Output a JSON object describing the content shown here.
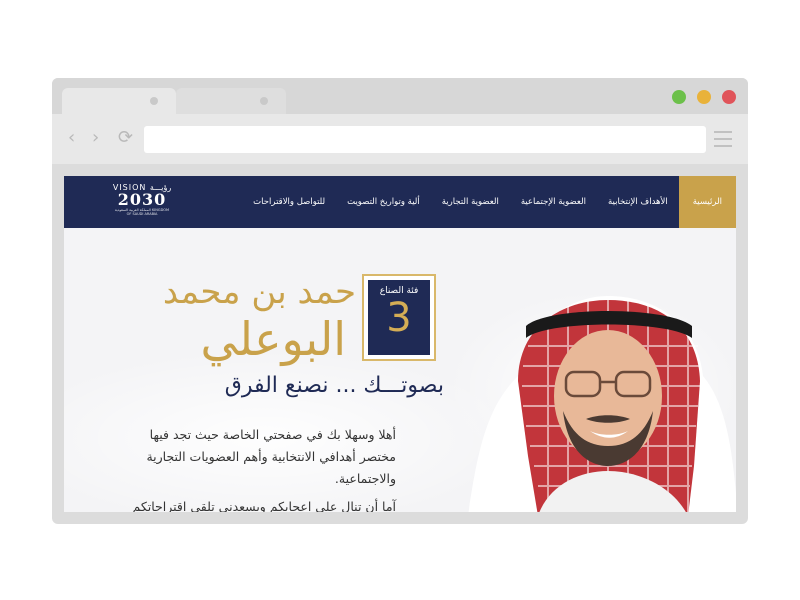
{
  "site": {
    "logo": {
      "line1": "VISION رؤيـــة",
      "line2": "2030",
      "line3": "المملكة العربية السعودية KINGDOM OF SAUDI ARABIA"
    },
    "menu": [
      {
        "label": "الرئيسية",
        "active": true
      },
      {
        "label": "الأهداف الإنتخابية",
        "active": false
      },
      {
        "label": "العضوية الإجتماعية",
        "active": false
      },
      {
        "label": "العضوية التجارية",
        "active": false
      },
      {
        "label": "ألية وتواريخ التصويت",
        "active": false
      },
      {
        "label": "للتواصل والاقتراحات",
        "active": false
      }
    ],
    "colors": {
      "navy": "#1f2a55",
      "gold": "#c9a24b"
    }
  },
  "hero": {
    "badge_category": "فئة الصناع",
    "badge_number": "3",
    "name_line1": "حمد بن محمد",
    "name_line2": "البوعلي",
    "slogan": "بصوتـــك ... نصنع الفرق",
    "intro_p1": "أهلا وسهلا بك في صفحتي الخاصة حيث تجد فيها مختصر أهدافي الانتخابية وأهم العضويات التجارية والاجتماعية.",
    "intro_p2": "آما أن تنال على اعجابكم ويسعدني تلقي اقتراحاتكم"
  }
}
